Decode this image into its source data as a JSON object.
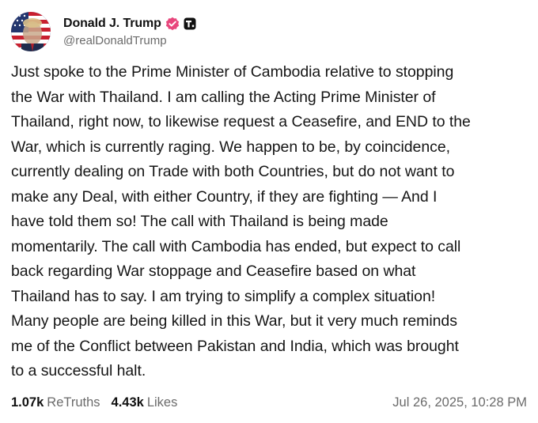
{
  "post": {
    "author": {
      "display_name": "Donald J. Trump",
      "handle": "@realDonaldTrump",
      "avatar_icon": "profile-avatar",
      "verified_icon": "verified-badge-icon",
      "verified_color": "#e8467c",
      "platform_icon": "truth-social-icon"
    },
    "text": "Just spoke to the Prime Minister of Cambodia relative to stopping\nthe War with Thailand. I am calling the Acting Prime Minister of\nThailand, right now, to likewise request a Ceasefire, and END to the\nWar, which is currently raging. We happen to be, by coincidence,\ncurrently dealing on Trade with both Countries, but do not want to\nmake any Deal, with either Country, if they are fighting — And I\nhave told them so! The call with Thailand is being made\nmomentarily. The call with Cambodia has ended, but expect to call\nback regarding War stoppage and Ceasefire based on what\nThailand has to say. I am trying to simplify a complex situation!\nMany people are being killed in this War, but it very much reminds\nme of the Conflict between Pakistan and India, which was brought\nto a successful halt.",
    "stats": {
      "retruths_count": "1.07k",
      "retruths_label": "ReTruths",
      "likes_count": "4.43k",
      "likes_label": "Likes"
    },
    "timestamp": "Jul 26, 2025, 10:28 PM"
  }
}
